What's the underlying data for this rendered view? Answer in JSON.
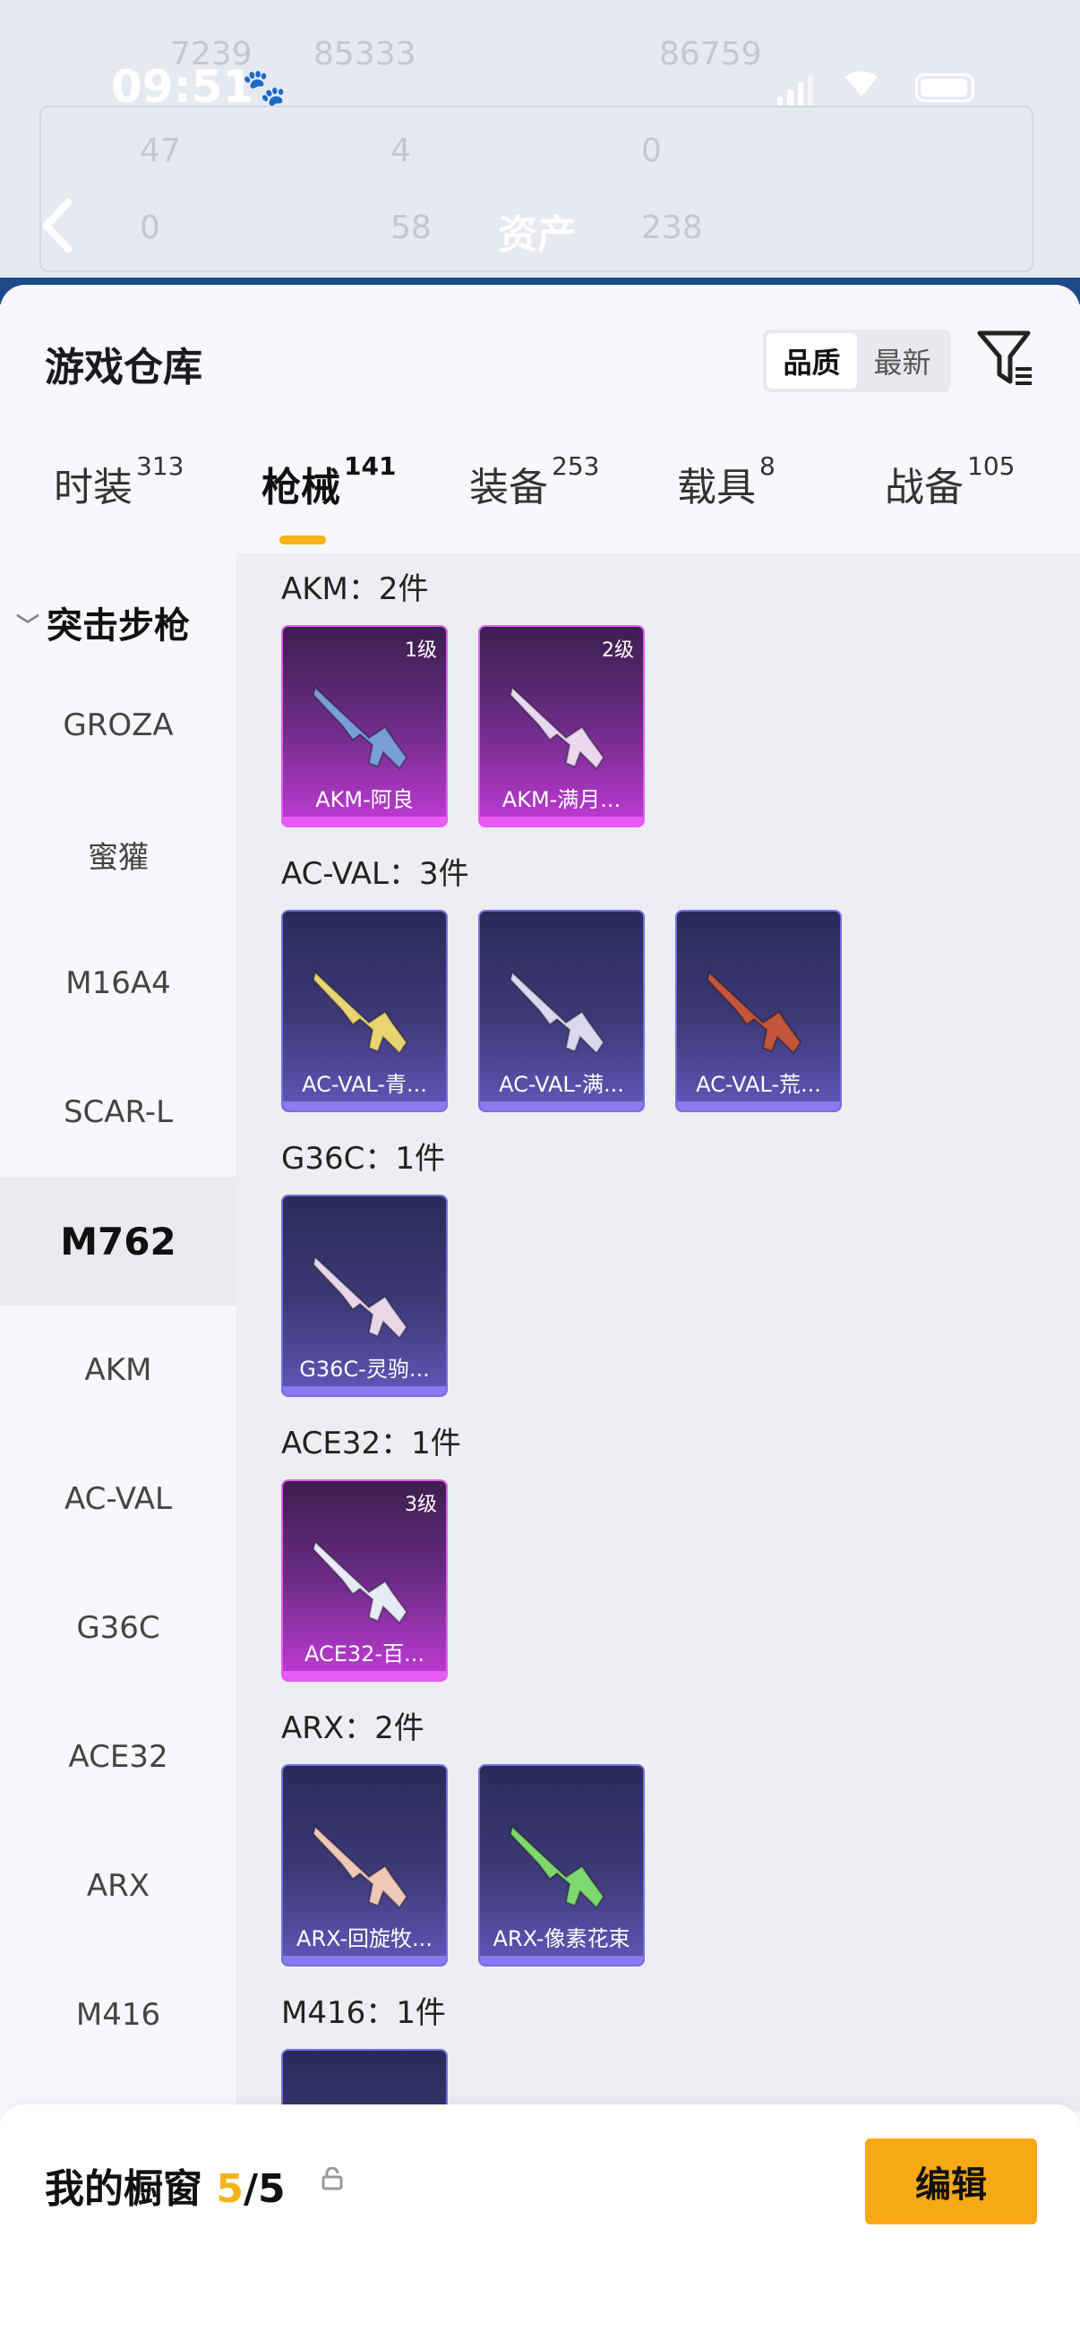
{
  "status_bar": {
    "time": "09:51"
  },
  "nav": {
    "title": "资产"
  },
  "background_stats": {
    "row1_left": "7239",
    "row1_mid": "85333",
    "row1_right": "86759",
    "row2": [
      "47",
      "4",
      "0"
    ],
    "row3": [
      "0",
      "58",
      "238"
    ]
  },
  "warehouse": {
    "title": "游戏仓库",
    "sort_options": [
      "品质",
      "最新"
    ],
    "sort_selected": "品质"
  },
  "tabs": [
    {
      "label": "时装",
      "count": "313"
    },
    {
      "label": "枪械",
      "count": "141"
    },
    {
      "label": "装备",
      "count": "253"
    },
    {
      "label": "载具",
      "count": "8"
    },
    {
      "label": "战备",
      "count": "105"
    }
  ],
  "sidebar": {
    "category": "突击步枪",
    "items": [
      "GROZA",
      "蜜獾",
      "M16A4",
      "SCAR-L",
      "M762",
      "AKM",
      "AC-VAL",
      "G36C",
      "ACE32",
      "ARX",
      "M416"
    ],
    "selected": "M762"
  },
  "groups": [
    {
      "title": "AKM：2件",
      "items": [
        {
          "name": "AKM-阿良",
          "level": "1级",
          "rarity": "pink",
          "gun_color": "#7a9ed8"
        },
        {
          "name": "AKM-满月...",
          "level": "2级",
          "rarity": "pink",
          "gun_color": "#e9d8f0"
        }
      ]
    },
    {
      "title": "AC-VAL：3件",
      "items": [
        {
          "name": "AC-VAL-青...",
          "level": "",
          "rarity": "blue",
          "gun_color": "#e8d470"
        },
        {
          "name": "AC-VAL-满...",
          "level": "",
          "rarity": "blue",
          "gun_color": "#dcd8ee"
        },
        {
          "name": "AC-VAL-荒...",
          "level": "",
          "rarity": "blue",
          "gun_color": "#c2553a"
        }
      ]
    },
    {
      "title": "G36C：1件",
      "items": [
        {
          "name": "G36C-灵驹...",
          "level": "",
          "rarity": "blue",
          "gun_color": "#e9d6e8"
        }
      ]
    },
    {
      "title": "ACE32：1件",
      "items": [
        {
          "name": "ACE32-百...",
          "level": "3级",
          "rarity": "pink",
          "gun_color": "#e8eaf6"
        }
      ]
    },
    {
      "title": "ARX：2件",
      "items": [
        {
          "name": "ARX-回旋牧...",
          "level": "",
          "rarity": "blue",
          "gun_color": "#f0c8b8"
        },
        {
          "name": "ARX-像素花束",
          "level": "",
          "rarity": "blue",
          "gun_color": "#7fd86e"
        }
      ]
    },
    {
      "title": "M416：1件",
      "items": [
        {
          "name": "",
          "level": "",
          "rarity": "blue",
          "gun_color": "#e8d470"
        }
      ]
    }
  ],
  "showcase": {
    "label": "我的橱窗",
    "current": "5",
    "total": "/5",
    "edit_label": "编辑"
  },
  "colors": {
    "accent": "#f5b21a",
    "pink_card": "#c13ad6",
    "blue_card": "#6057b8"
  }
}
